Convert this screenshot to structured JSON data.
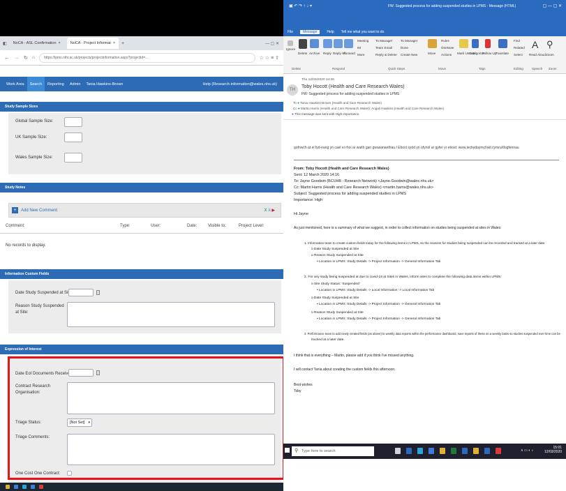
{
  "browser": {
    "tabs": [
      {
        "label": "NoCA - ASL Confirmation",
        "close": "×"
      },
      {
        "label": "NoCA - Project Informat",
        "close": "×"
      }
    ],
    "new_tab": "+",
    "url": "https://lpms.nihr.ac.uk/projects/projectinformation.aspx?projectid=..."
  },
  "nav": {
    "items": [
      "Work Area",
      "Search",
      "Reporting",
      "Admin",
      "Tania Hawkins-Brown"
    ],
    "help": "Help (Research-information@wales.nhs.uk)"
  },
  "study_sample": {
    "header": "Study Sample Sizes",
    "global_label": "Global Sample Size:",
    "uk_label": "UK Sample Size:",
    "wales_label": "Wales Sample Size:"
  },
  "study_notes": {
    "header": "Study Notes",
    "add_comment": "Add New Comment",
    "columns": [
      "Comment:",
      "Type:",
      "User:",
      "Date:",
      "Visible to:",
      "Project Level:"
    ],
    "empty": "No records to display."
  },
  "custom_fields": {
    "header": "Information Custom Fields",
    "date_label": "Date Study Suspended at Site:",
    "reason_label": "Reason Study Suspended at Site:"
  },
  "eoi": {
    "header": "Expression of Interest",
    "edd_label": "Date EoI Documents Received:",
    "cro_label": "Contract Research Organisation:",
    "triage_label": "Triage Status:",
    "triage_value": "[Not Set]",
    "comments_label": "Triage Comments:",
    "ocoe_label": "One Cost One Contract:"
  },
  "outlook": {
    "title": "FW: Suggested process for adding suspended studies in LPMS - Message (HTML)",
    "ribbon_tabs": [
      "File",
      "Message",
      "Help",
      "Tell me what you want to do"
    ],
    "groups": [
      "Delete",
      "Respond",
      "Quick Steps",
      "Move",
      "Tags",
      "Editing",
      "Speech",
      "Zoom"
    ],
    "ribbon_buttons": [
      "Ignore",
      "Delete",
      "Archive",
      "Reply",
      "Reply All",
      "Forward",
      "Meeting",
      "IM",
      "More",
      "To Manager",
      "Team Email",
      "Reply & Delete",
      "To Manager",
      "Done",
      "Create New",
      "Move",
      "Rules",
      "OneNote",
      "Actions",
      "Mark Unread",
      "Categorize",
      "Follow Up",
      "Translate",
      "Find",
      "Related",
      "Select",
      "Read Aloud",
      "Zoom"
    ],
    "header_date": "Thu 12/03/2020 14:26",
    "sender": "Toby Hocott (Health and Care Research Wales)",
    "subject_short": "FW: Suggested process for adding suspended studies in LPMS",
    "to1": "Tania Hawkins-Brown (Health and Care Research Wales)",
    "to2": "Martin Harris (Health and Care Research Wales);   Angali Hawkins (Health and Care Research Wales)",
    "importance_note": "This message was sent with High importance.",
    "banner": "gofnwch at ei fyd-eang yn cael ei rhoi ar waith gan gwasanaethau / Ebost sydd yn ofynol ar gyfer yr ebost: www.iechydaymchwil.cymru/dogfennau",
    "from": "From: Toby Hocott (Health and Care Research Wales)",
    "sent": "Sent: 12 March 2020 14:16",
    "to": "To: Jayne Goodwin (BCUHB - Research Network) <Jayne.Goodwin@wales.nhs.uk>",
    "cc": "Cc: Martin Harris (Health and Care Research Wales) <martin.harris@wales.nhs.uk>",
    "subject": "Subject: Suggested process for adding suspended studies in LPMS",
    "importance": "Importance: High",
    "greeting": "Hi Jayne",
    "intro": "As just mentioned, here is a summary of what we suggest, in order to collect information on studies being suspended at sites in Wales:",
    "item1": "1.   Information team to create custom fields today for the following items in LPMS, so the reasons for studies being suspended can be recorded and tracked at a later date:",
    "item1_a": "o   Date Study Suspended at Site",
    "item1_b": "o   Reason Study Suspended at Site",
    "item1_loc": "•   Location in LPMS: Study Details -> Project Information -> General Information Tab",
    "item2": "2.   For any study being suspended at due to covid-19 at Sites in Wales, inform sites to complete the following data items within LPMS:",
    "item2_a": "o   Site Study Status: 'Suspended'",
    "item2_a_loc": "•   Location in LPMS: Study Details -> Local Information -> Local Information Tab",
    "item2_b": "o   Date Study Suspended at Site",
    "item2_b_loc": "•   Location in LPMS: Study Details -> Project Information -> General Information Tab",
    "item2_c": "o   Reason Study Suspended at Site",
    "item2_c_loc": "•   Location in LPMS: Study Details -> Project Information -> General Information Tab",
    "item3a": "3.   Performance team to add newly created fields (as above) to weekly data reports within the performance dashboard, save reports of these on a weekly basis so studies suspended over time can be",
    "item3b": "tracked at a later date.",
    "closing1": "I think that is everything – Martin, please add if you think I've missed anything.",
    "closing2": "I will contact Tania about creating the custom fields this afternoon.",
    "signoff": "Best wishes",
    "name": "Toby"
  },
  "taskbar": {
    "search_placeholder": "Type here to search",
    "time": "15:01",
    "date": "12/03/2020"
  },
  "colors": {
    "nav_blue": "#2d6cb4",
    "outlook_blue": "#2b6bbf",
    "highlight_red": "#e8141b"
  }
}
